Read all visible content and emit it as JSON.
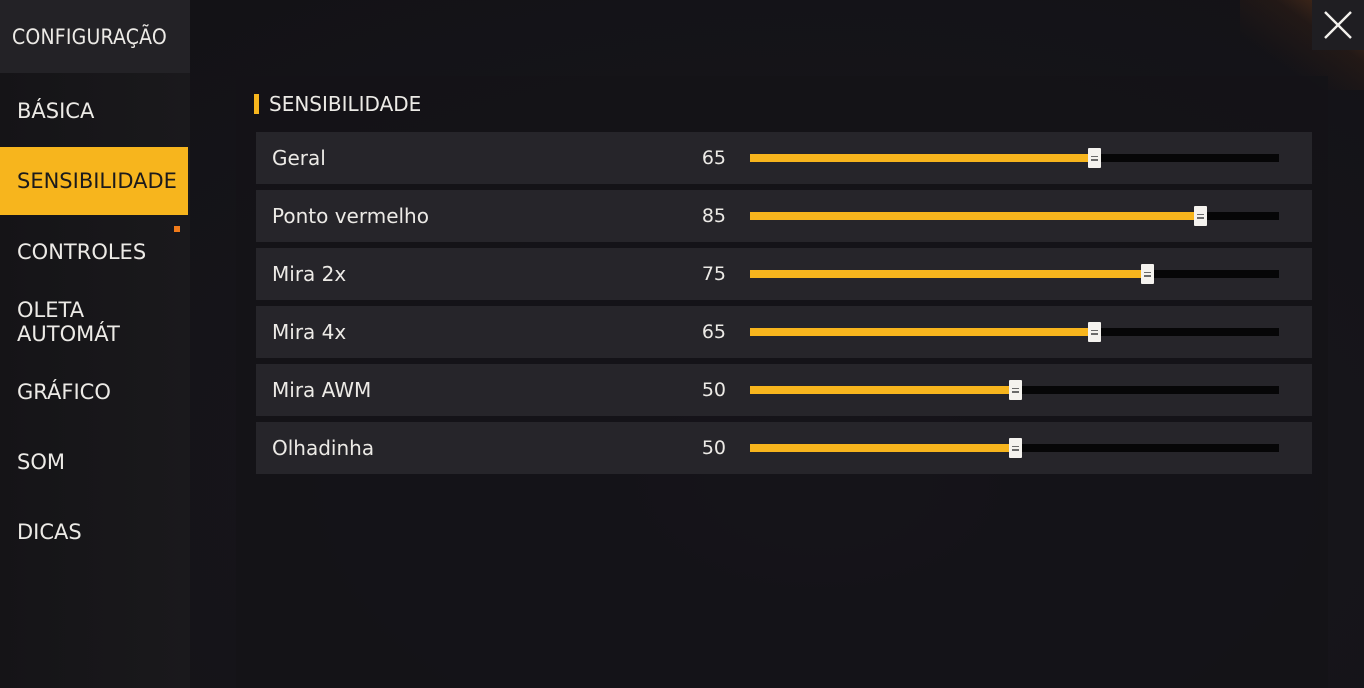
{
  "sidebar": {
    "title": "CONFIGURAÇÃO",
    "items": [
      {
        "label": "BÁSICA"
      },
      {
        "label": "SENSIBILIDADE",
        "active": true
      },
      {
        "label": "CONTROLES"
      },
      {
        "label": "OLETA AUTOMÁT"
      },
      {
        "label": "GRÁFICO"
      },
      {
        "label": "SOM"
      },
      {
        "label": "DICAS"
      }
    ]
  },
  "close": {
    "icon": "close-icon"
  },
  "section": {
    "title": "SENSIBILIDADE"
  },
  "sliders": [
    {
      "label": "Geral",
      "value": "65",
      "fraction": 0.65
    },
    {
      "label": "Ponto vermelho",
      "value": "85",
      "fraction": 0.85
    },
    {
      "label": "Mira 2x",
      "value": "75",
      "fraction": 0.75
    },
    {
      "label": "Mira 4x",
      "value": "65",
      "fraction": 0.65
    },
    {
      "label": "Mira AWM",
      "value": "50",
      "fraction": 0.5
    },
    {
      "label": "Olhadinha",
      "value": "50",
      "fraction": 0.5
    }
  ],
  "colors": {
    "accent": "#f7b51d",
    "track": "#060607"
  }
}
